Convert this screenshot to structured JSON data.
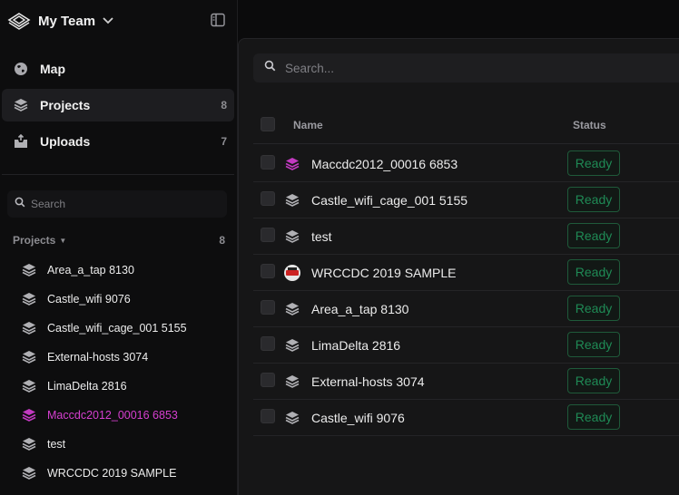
{
  "team": {
    "name": "My Team"
  },
  "nav": [
    {
      "label": "Map",
      "count": ""
    },
    {
      "label": "Projects",
      "count": "8"
    },
    {
      "label": "Uploads",
      "count": "7"
    }
  ],
  "sidebar_search": {
    "placeholder": "Search"
  },
  "projects_section": {
    "label": "Projects",
    "count": "8"
  },
  "sidebar_projects": [
    "Area_a_tap 8130",
    "Castle_wifi 9076",
    "Castle_wifi_cage_001 5155",
    "External-hosts 3074",
    "LimaDelta 2816",
    "Maccdc2012_00016 6853",
    "test",
    "WRCCDC 2019 SAMPLE"
  ],
  "main_search": {
    "placeholder": "Search..."
  },
  "table": {
    "headers": {
      "name": "Name",
      "status": "Status"
    },
    "rows": [
      {
        "name": "Maccdc2012_00016 6853",
        "status": "Ready",
        "icon": "layers-icon-magenta"
      },
      {
        "name": "Castle_wifi_cage_001 5155",
        "status": "Ready",
        "icon": "layers-icon"
      },
      {
        "name": "test",
        "status": "Ready",
        "icon": "layers-icon"
      },
      {
        "name": "WRCCDC 2019 SAMPLE",
        "status": "Ready",
        "icon": "wrccdc-logo-icon"
      },
      {
        "name": "Area_a_tap 8130",
        "status": "Ready",
        "icon": "layers-icon"
      },
      {
        "name": "LimaDelta 2816",
        "status": "Ready",
        "icon": "layers-icon"
      },
      {
        "name": "External-hosts 3074",
        "status": "Ready",
        "icon": "layers-icon"
      },
      {
        "name": "Castle_wifi 9076",
        "status": "Ready",
        "icon": "layers-icon"
      }
    ]
  },
  "colors": {
    "accent_magenta": "#d63fd0",
    "ready_green": "#1f8a55",
    "background": "#0b0b0c"
  }
}
